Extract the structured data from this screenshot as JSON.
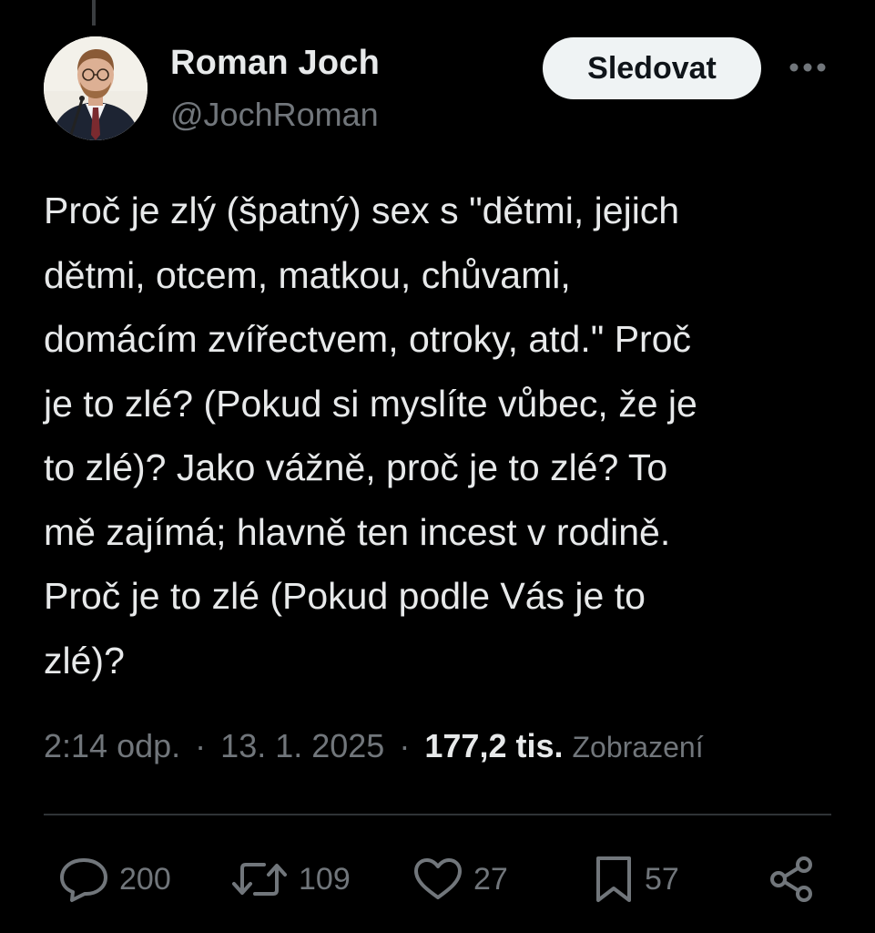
{
  "author": {
    "display_name": "Roman Joch",
    "handle": "@JochRoman"
  },
  "header": {
    "follow_label": "Sledovat"
  },
  "tweet": {
    "text": "Proč je zlý (špatný) sex s \"dětmi, jejich\ndětmi, otcem, matkou, chůvami,\ndomácím zvířectvem, otroky, atd.\" Proč\nje to zlé? (Pokud si myslíte vůbec, že je\nto zlé)? Jako vážně, proč je to zlé? To\nmě zajímá; hlavně ten incest v rodině.\nProč je to zlé (Pokud podle Vás je to\nzlé)?"
  },
  "meta": {
    "time": "2:14 odp.",
    "separator": "·",
    "date": "13. 1. 2025",
    "views_count": "177,2 tis.",
    "views_label": "Zobrazení"
  },
  "actions": {
    "replies": "200",
    "reposts": "109",
    "likes": "27",
    "bookmarks": "57"
  },
  "colors": {
    "background": "#000000",
    "text_primary": "#e7e9ea",
    "text_secondary": "#71767b",
    "divider": "#2f3336",
    "follow_bg": "#eff3f4"
  }
}
